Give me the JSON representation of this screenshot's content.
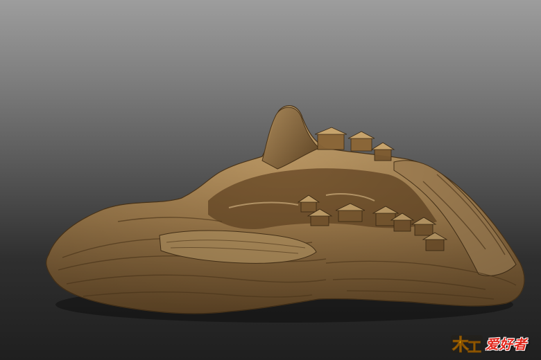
{
  "scene": {
    "subject": "wood-root-carving-mountain-village",
    "colors": {
      "wood_light": "#c9a772",
      "wood_mid": "#9a7748",
      "wood_dark": "#5b4122",
      "background_top": "#9d9d9d",
      "background_bottom": "#1f1f1f"
    }
  },
  "watermark": {
    "logo_mark": "木",
    "logo_mark_sub": "工",
    "logo_text": "爱好者",
    "accent_color": "#e3261b",
    "mark_color": "#f5b400"
  }
}
